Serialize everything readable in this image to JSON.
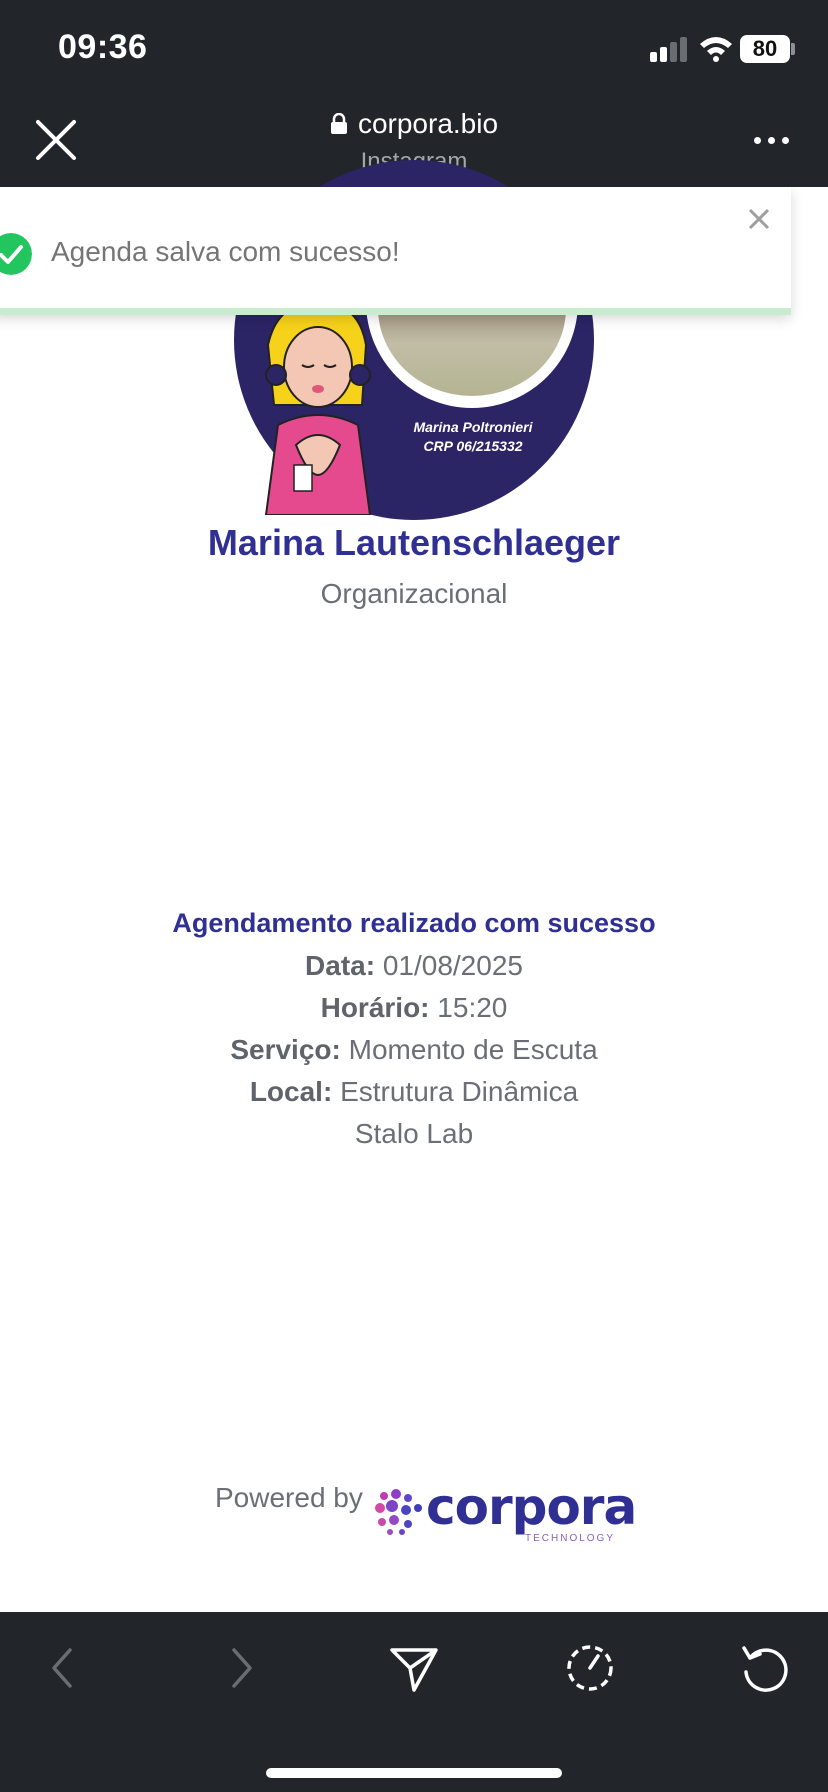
{
  "status_bar": {
    "time": "09:36",
    "battery": "80"
  },
  "browser": {
    "url": "corpora.bio",
    "source": "Instagram"
  },
  "toast": {
    "message": "Agenda salva com sucesso!"
  },
  "profile": {
    "photo_caption_line1": "Marina Poltronieri",
    "photo_caption_line2": "CRP 06/215332",
    "name": "Marina Lautenschlaeger",
    "role": "Organizacional"
  },
  "confirmation": {
    "title": "Agendamento realizado com sucesso",
    "date_label": "Data:",
    "date_value": "01/08/2025",
    "time_label": "Horário:",
    "time_value": "15:20",
    "service_label": "Serviço:",
    "service_value": "Momento de Escuta",
    "location_label": "Local:",
    "location_value": "Estrutura Dinâmica",
    "location_extra": "Stalo Lab"
  },
  "footer": {
    "powered_by": "Powered by",
    "brand": "corpora",
    "brand_sub": "TECHNOLOGY"
  },
  "colors": {
    "accent": "#302f93",
    "chrome": "#222529",
    "success": "#22c55e"
  }
}
